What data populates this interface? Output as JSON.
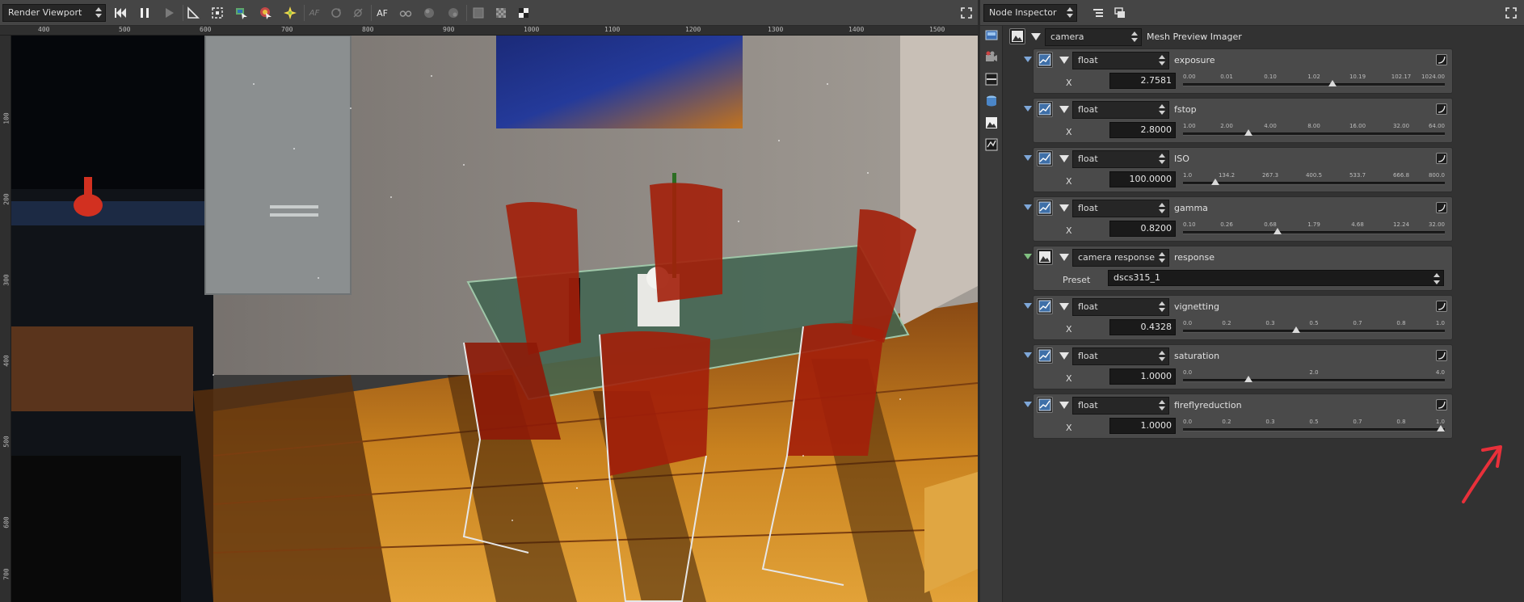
{
  "viewport": {
    "panel_select": "Render Viewport",
    "toolbar_text": {
      "af1": "AF",
      "af2": "AF"
    },
    "ruler_top": [
      "400",
      "500",
      "600",
      "700",
      "800",
      "900",
      "1000",
      "1100",
      "1200",
      "1300",
      "1400",
      "1500"
    ],
    "ruler_left": [
      "100",
      "200",
      "300",
      "400",
      "500",
      "600",
      "700"
    ]
  },
  "inspector": {
    "panel_select": "Node Inspector",
    "camera_node": {
      "type": "camera",
      "name": "Mesh Preview Imager"
    },
    "groups": [
      {
        "type": "float",
        "name": "exposure",
        "axis": "X",
        "value": "2.7581",
        "ticks": [
          "0.00",
          "0.01",
          "0.10",
          "1.02",
          "10.19",
          "102.17",
          "1024.00"
        ],
        "level": 0.57
      },
      {
        "type": "float",
        "name": "fstop",
        "axis": "X",
        "value": "2.8000",
        "ticks": [
          "1.00",
          "2.00",
          "4.00",
          "8.00",
          "16.00",
          "32.00",
          "64.00"
        ],
        "level": 0.25
      },
      {
        "type": "float",
        "name": "ISO",
        "axis": "X",
        "value": "100.0000",
        "ticks": [
          "1.0",
          "134.2",
          "267.3",
          "400.5",
          "533.7",
          "666.8",
          "800.0"
        ],
        "level": 0.124
      },
      {
        "type": "float",
        "name": "gamma",
        "axis": "X",
        "value": "0.8200",
        "ticks": [
          "0.10",
          "0.26",
          "0.68",
          "1.79",
          "4.68",
          "12.24",
          "32.00"
        ],
        "level": 0.36
      },
      {
        "type": "camera response",
        "name": "response",
        "preset_label": "Preset",
        "preset": "dscs315_1"
      },
      {
        "type": "float",
        "name": "vignetting",
        "axis": "X",
        "value": "0.4328",
        "ticks": [
          "0.0",
          "0.2",
          "0.3",
          "0.5",
          "0.7",
          "0.8",
          "1.0"
        ],
        "level": 0.4328
      },
      {
        "type": "float",
        "name": "saturation",
        "axis": "X",
        "value": "1.0000",
        "ticks": [
          "0.0",
          "2.0",
          "4.0"
        ],
        "level": 0.25
      },
      {
        "type": "float",
        "name": "fireflyreduction",
        "axis": "X",
        "value": "1.0000",
        "ticks": [
          "0.0",
          "0.2",
          "0.3",
          "0.5",
          "0.7",
          "0.8",
          "1.0"
        ],
        "level": 1.0
      }
    ]
  },
  "colors": {
    "annotation_arrow": "#e8303a",
    "panel": "#4a4a4a",
    "input": "#1a1a1a"
  }
}
